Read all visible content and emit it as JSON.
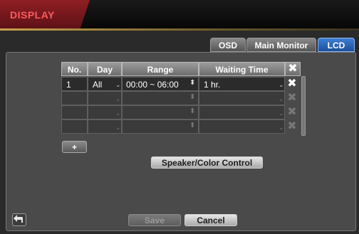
{
  "window": {
    "title": "DISPLAY"
  },
  "tabs": [
    {
      "label": "OSD",
      "active": false
    },
    {
      "label": "Main Monitor",
      "active": false
    },
    {
      "label": "LCD",
      "active": true
    }
  ],
  "table": {
    "headers": [
      "No.",
      "Day",
      "Range",
      "Waiting Time"
    ],
    "rows": [
      {
        "no": "1",
        "day": "All",
        "range": "00:00 ~ 06:00",
        "waiting": "1 hr."
      },
      {
        "no": "",
        "day": "",
        "range": "",
        "waiting": ""
      },
      {
        "no": "",
        "day": "",
        "range": "",
        "waiting": ""
      },
      {
        "no": "",
        "day": "",
        "range": "",
        "waiting": ""
      }
    ]
  },
  "buttons": {
    "add": "+",
    "speaker_color": "Speaker/Color Control",
    "save": "Save",
    "cancel": "Cancel"
  },
  "icons": {
    "delete": "close-x",
    "back": "return-arrow"
  },
  "colors": {
    "accent_red": "#ff5a5f",
    "tab_active": "#2e66b8"
  }
}
